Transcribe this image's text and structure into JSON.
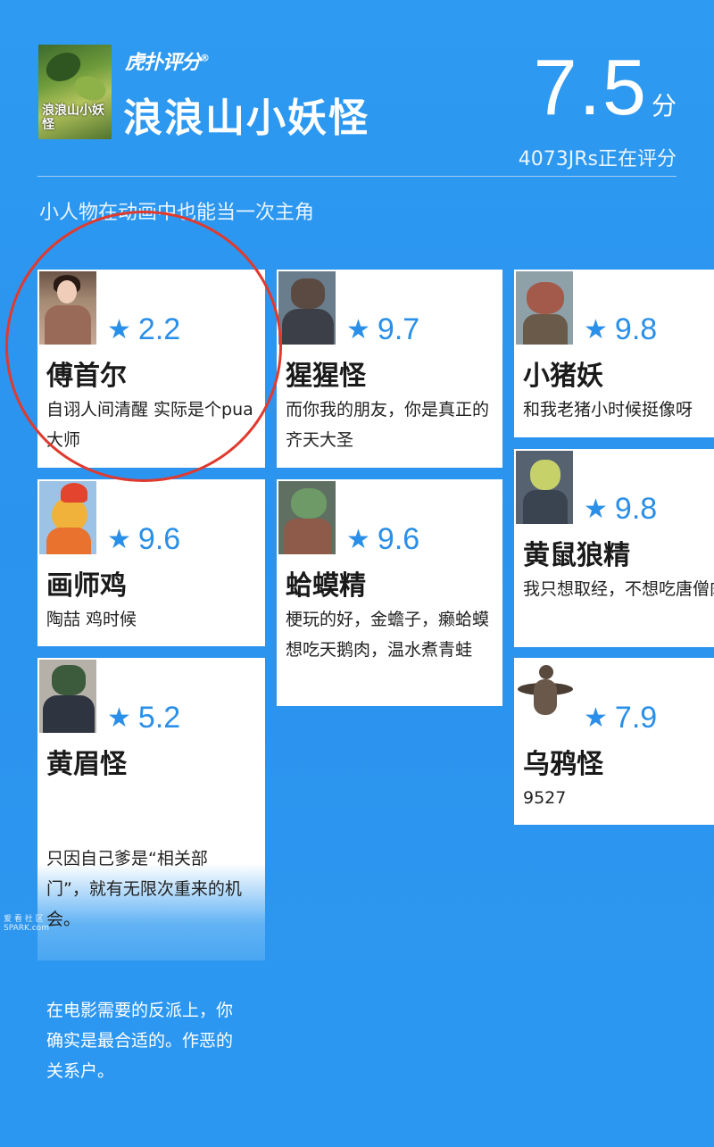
{
  "header": {
    "logo_text": "虎扑评分",
    "logo_mark": "®",
    "poster_title": "浪浪山小妖怪",
    "title": "浪浪山小妖怪",
    "score": "7.5",
    "score_unit": "分",
    "rating_count": "4073JRs正在评分",
    "subtitle": "小人物在动画中也能当一次主角"
  },
  "cards": [
    {
      "name": "傅首尔",
      "rating": "2.2",
      "comment": "自诩人间清醒 实际是个pua大师",
      "avatar_icon": "woman-portrait"
    },
    {
      "name": "猩猩怪",
      "rating": "9.7",
      "comment": "而你我的朋友，你是真正的齐天大圣",
      "avatar_icon": "ape-portrait"
    },
    {
      "name": "小猪妖",
      "rating": "9.8",
      "comment": "和我老猪小时候挺像呀",
      "avatar_icon": "pig-portrait"
    },
    {
      "name": "画师鸡",
      "rating": "9.6",
      "comment": "陶喆 鸡时候",
      "avatar_icon": "rooster-portrait"
    },
    {
      "name": "蛤蟆精",
      "rating": "9.6",
      "comment": "梗玩的好，金蟾子，癞蛤蟆想吃天鹅肉，温水煮青蛙",
      "avatar_icon": "toad-portrait"
    },
    {
      "name": "黄鼠狼精",
      "rating": "9.8",
      "comment": "我只想取经，不想吃唐僧肉",
      "avatar_icon": "weasel-portrait"
    },
    {
      "name": "黄眉怪",
      "rating": "5.2",
      "comment": "只因自己爹是“相关部门”，就有无限次重来的机会。",
      "comment_extra": "在电影需要的反派上，你确实是最合适的。作恶的关系户。",
      "avatar_icon": "yellow-brow-portrait"
    },
    {
      "name": "乌鸦怪",
      "rating": "7.9",
      "comment": "9527",
      "avatar_icon": "crow-portrait"
    }
  ],
  "watermark": "爱 看 社 区\nSPARK.com"
}
